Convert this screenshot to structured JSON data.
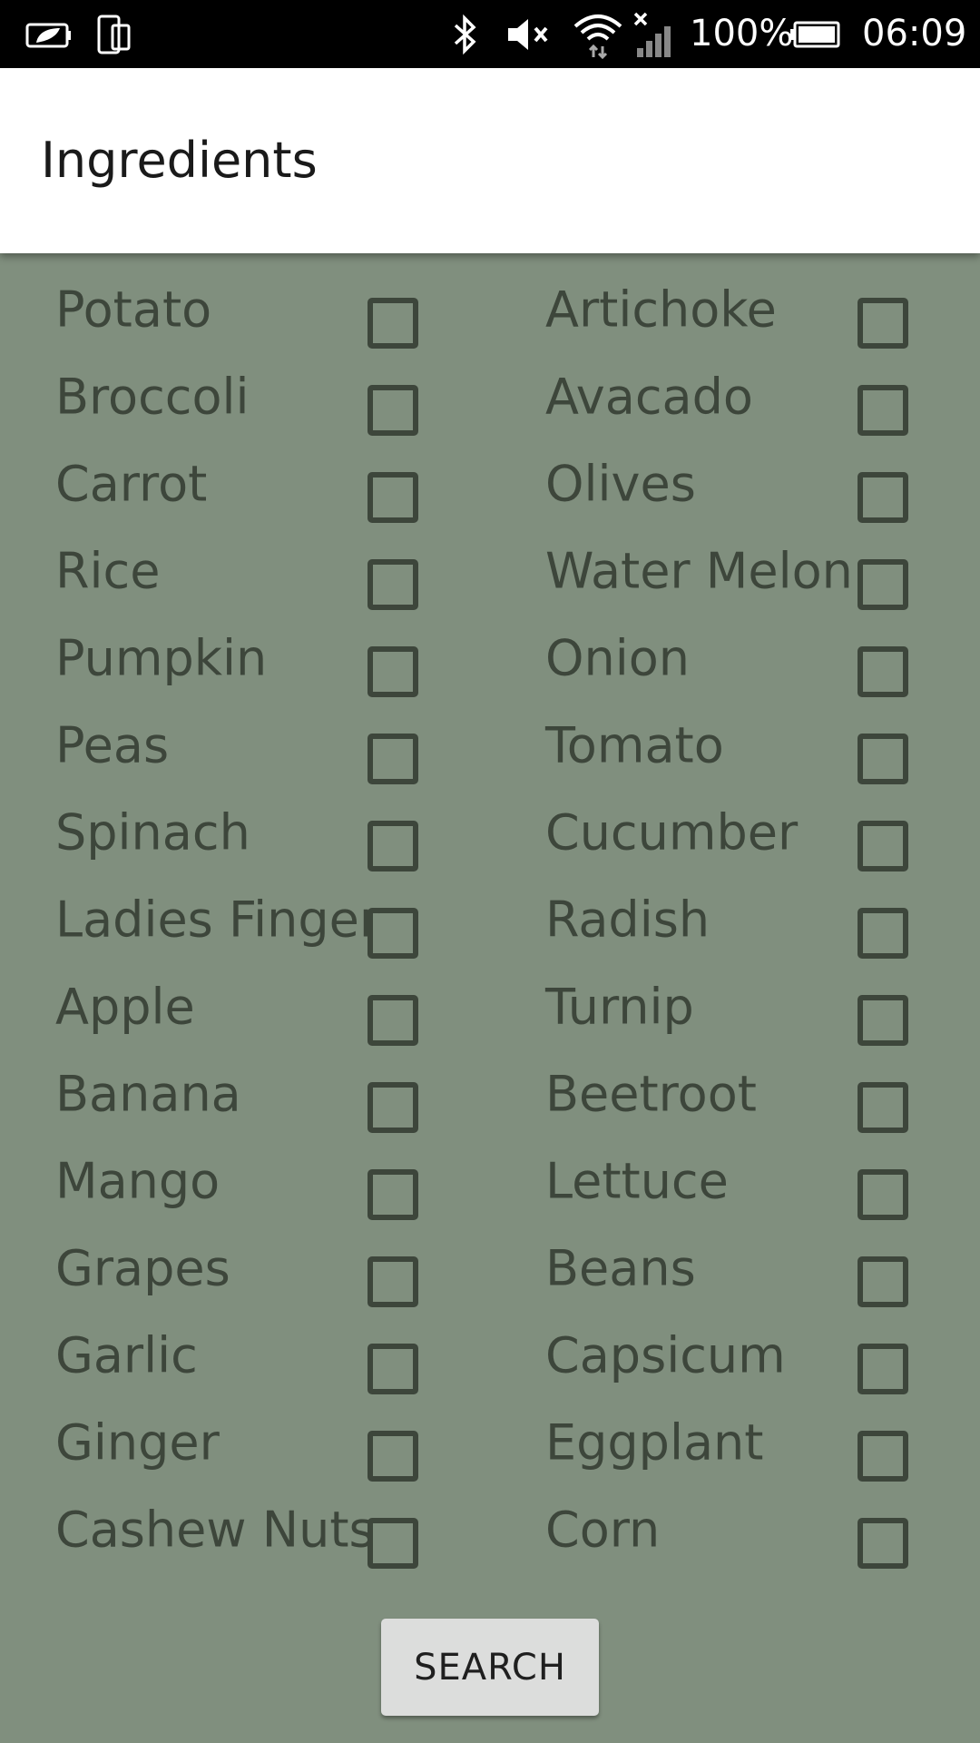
{
  "status_bar": {
    "battery_percent": "100%",
    "time": "06:09",
    "icons": [
      "leaf-battery-icon",
      "phone-screen-icon",
      "bluetooth-icon",
      "mute-icon",
      "wifi-icon",
      "signal-icon",
      "battery-icon"
    ]
  },
  "app_bar": {
    "title": "Ingredients"
  },
  "ingredients": {
    "left": [
      "Potato",
      "Broccoli",
      "Carrot",
      "Rice",
      "Pumpkin",
      "Peas",
      "Spinach",
      "Ladies Finger",
      "Apple",
      "Banana",
      "Mango",
      "Grapes",
      "Garlic",
      "Ginger",
      "Cashew Nuts"
    ],
    "right": [
      "Artichoke",
      "Avacado",
      "Olives",
      "Water Melon",
      "Onion",
      "Tomato",
      "Cucumber",
      "Radish",
      "Turnip",
      "Beetroot",
      "Lettuce",
      "Beans",
      "Capsicum",
      "Eggplant",
      "Corn"
    ],
    "checked": false
  },
  "search_button": {
    "label": "SEARCH"
  },
  "colors": {
    "background": "#808f7e",
    "text": "#3d463b",
    "app_bar": "#ffffff",
    "button": "#dcdddc"
  }
}
